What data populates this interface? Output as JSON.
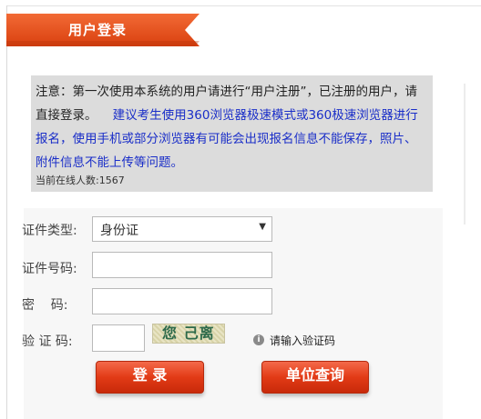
{
  "header": {
    "title": "用户登录"
  },
  "notice": {
    "text_black": "注意：第一次使用本系统的用户请进行“用户注册”，已注册的用户，请直接登录。",
    "text_blue": "建议考生使用360浏览器极速模式或360极速浏览器进行报名，使用手机或部分浏览器有可能会出现报名信息不能保存，照片、附件信息不能上传等问题。",
    "online_count": "当前在线人数:1567"
  },
  "form": {
    "id_type_label": "证件类型:",
    "id_type_value": "身份证",
    "id_number_label": "证件号码:",
    "id_number_value": "",
    "password_label": "密    码:",
    "password_value": "",
    "captcha_label": "验 证 码:",
    "captcha_value": "",
    "captcha_image_text": "您 己离",
    "captcha_hint": "请输入验证码"
  },
  "buttons": {
    "login": "登 录",
    "unit_query": "单位查询"
  },
  "colors": {
    "title_orange": "#e8501f",
    "notice_bg": "#dcdcdc",
    "notice_blue": "#1a2ec8",
    "button_red": "#e23b16"
  }
}
